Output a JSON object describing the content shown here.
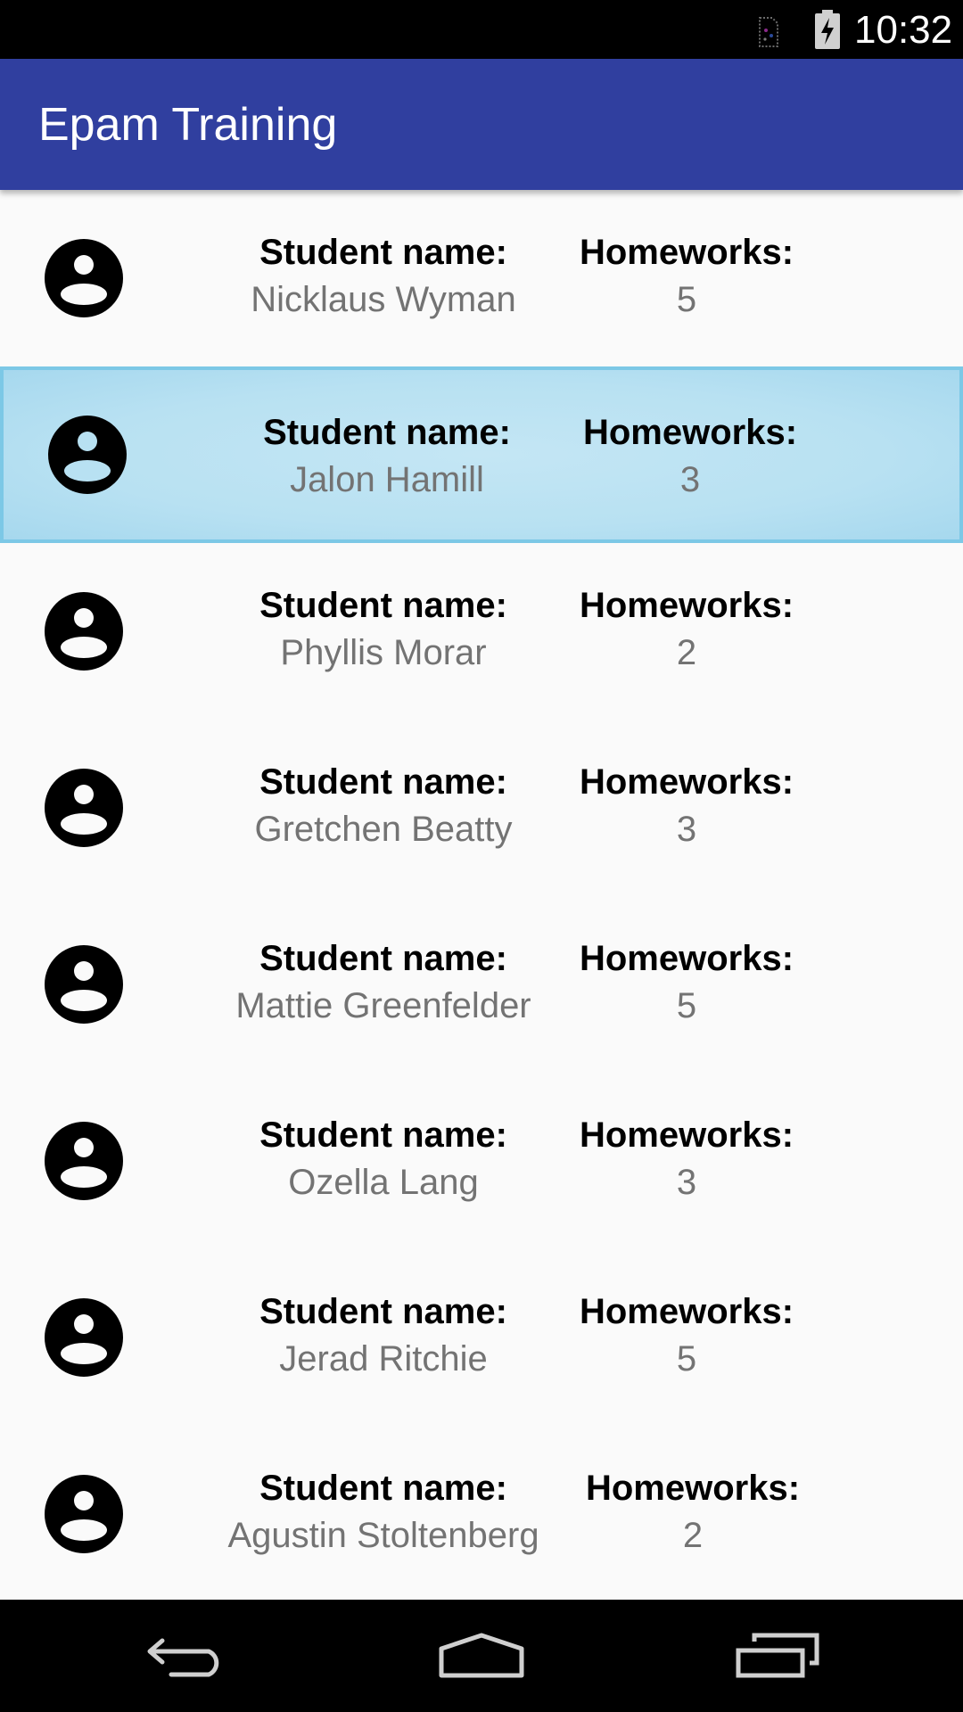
{
  "status_bar": {
    "time": "10:32"
  },
  "app_bar": {
    "title": "Epam Training"
  },
  "list": {
    "name_label": "Student name:",
    "homeworks_label": "Homeworks:",
    "items": [
      {
        "name": "Nicklaus Wyman",
        "homeworks": "5"
      },
      {
        "name": "Jalon Hamill",
        "homeworks": "3"
      },
      {
        "name": "Phyllis Morar",
        "homeworks": "2"
      },
      {
        "name": "Gretchen Beatty",
        "homeworks": "3"
      },
      {
        "name": "Mattie Greenfelder",
        "homeworks": "5"
      },
      {
        "name": "Ozella Lang",
        "homeworks": "3"
      },
      {
        "name": "Jerad Ritchie",
        "homeworks": "5"
      },
      {
        "name": "Agustin Stoltenberg",
        "homeworks": "2"
      }
    ]
  },
  "selected_index": 1,
  "colors": {
    "primary": "#303f9f",
    "selected_background": "#b8e1f2",
    "selected_border": "#7cc8e6",
    "value_text": "#737373"
  },
  "icons": {
    "avatar": "account-circle-icon",
    "back": "back-icon",
    "home": "home-icon",
    "recents": "recents-icon",
    "battery": "battery-charging-icon",
    "sim": "no-sim-icon"
  }
}
